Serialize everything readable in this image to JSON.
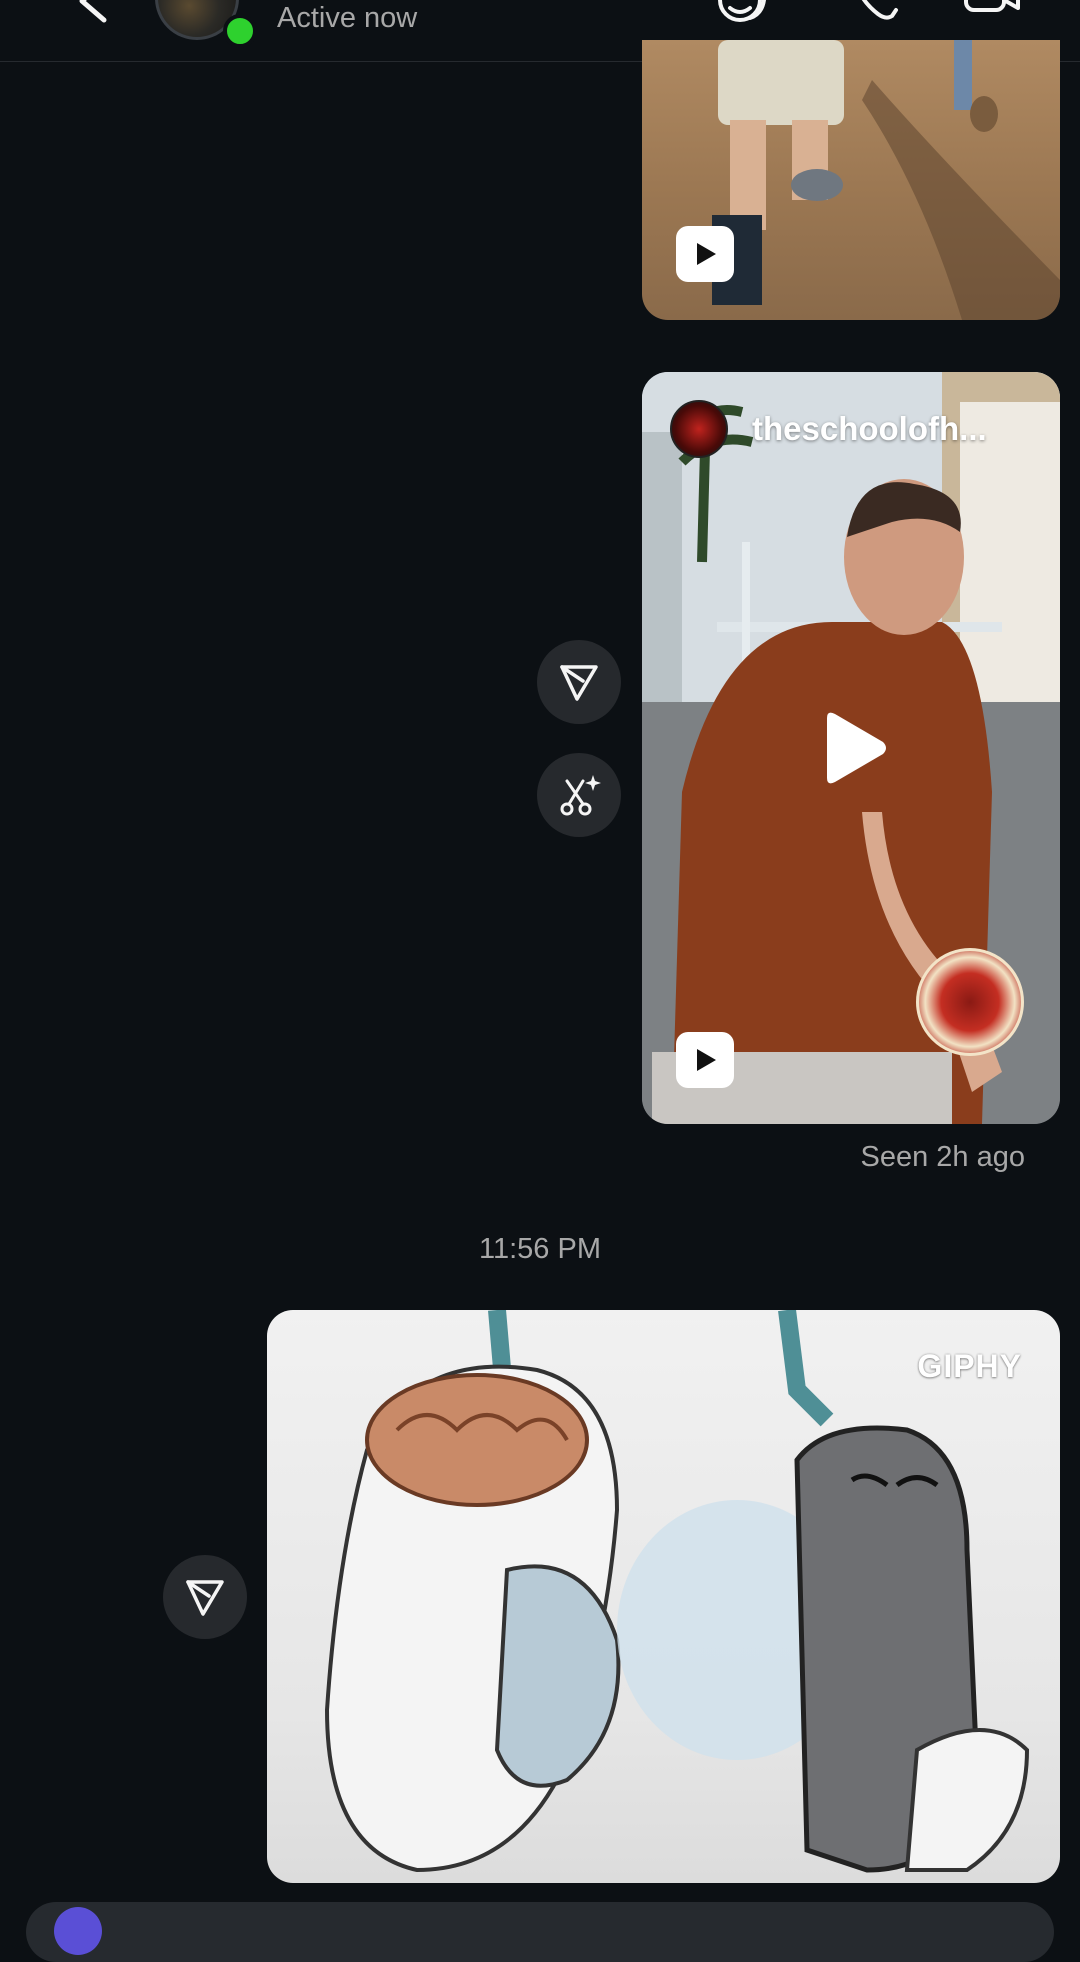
{
  "header": {
    "status": "Active now",
    "icons": [
      "back-icon",
      "sticker-icon",
      "phone-icon",
      "video-icon"
    ]
  },
  "messages": {
    "reel_1": {
      "type": "reel",
      "play_icon": "play-icon"
    },
    "reel_2": {
      "type": "reel",
      "username": "theschoolofh...",
      "play_icon": "play-icon"
    },
    "reel_2_actions": [
      "share-icon",
      "ai-cut-icon"
    ],
    "seen_status": "Seen 2h ago",
    "time_divider": "11:56 PM",
    "gif": {
      "type": "gif",
      "source_label": "GIPHY"
    },
    "gif_actions": [
      "share-icon"
    ]
  },
  "colors": {
    "background": "#0c1014",
    "online": "#2ed12e",
    "secondary_text": "#a8a8a8",
    "button_bg": "#26292d"
  }
}
